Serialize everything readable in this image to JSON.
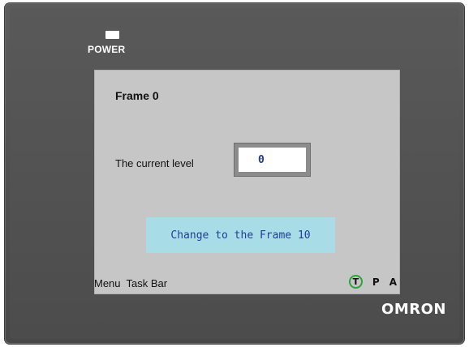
{
  "device": {
    "power_label": "POWER",
    "brand_logo": "OMRON",
    "colors": {
      "bezel": "#525252",
      "screen_background": "#c6c6c6",
      "button_background": "#a8dde8",
      "button_text": "#1e3f96",
      "t_indicator_ring": "#2aa53a"
    }
  },
  "screen": {
    "frame_title": "Frame 0",
    "level_label": "The current level",
    "level_value": "0",
    "change_button_label": "Change to the Frame 10",
    "menu_taskbar_label": "Menu  Task Bar",
    "indicators": [
      "T",
      "P",
      "A"
    ]
  }
}
